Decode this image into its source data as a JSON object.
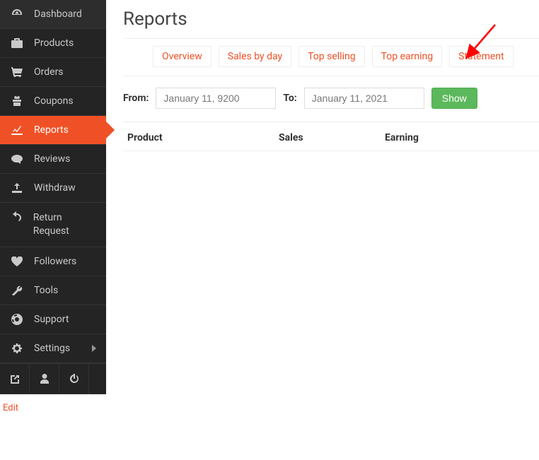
{
  "sidebar": {
    "items": [
      {
        "label": "Dashboard"
      },
      {
        "label": "Products"
      },
      {
        "label": "Orders"
      },
      {
        "label": "Coupons"
      },
      {
        "label": "Reports"
      },
      {
        "label": "Reviews"
      },
      {
        "label": "Withdraw"
      },
      {
        "label": "Return Request"
      },
      {
        "label": "Followers"
      },
      {
        "label": "Tools"
      },
      {
        "label": "Support"
      },
      {
        "label": "Settings"
      }
    ],
    "edit": "Edit"
  },
  "page": {
    "title": "Reports"
  },
  "tabs": {
    "overview": "Overview",
    "sales_by_day": "Sales by day",
    "top_selling": "Top selling",
    "top_earning": "Top earning",
    "statement": "Statement"
  },
  "filter": {
    "from_label": "From:",
    "to_label": "To:",
    "from_value": "January 11, 9200",
    "to_value": "January 11, 2021",
    "show_button": "Show"
  },
  "table": {
    "headers": {
      "product": "Product",
      "sales": "Sales",
      "earning": "Earning"
    }
  }
}
